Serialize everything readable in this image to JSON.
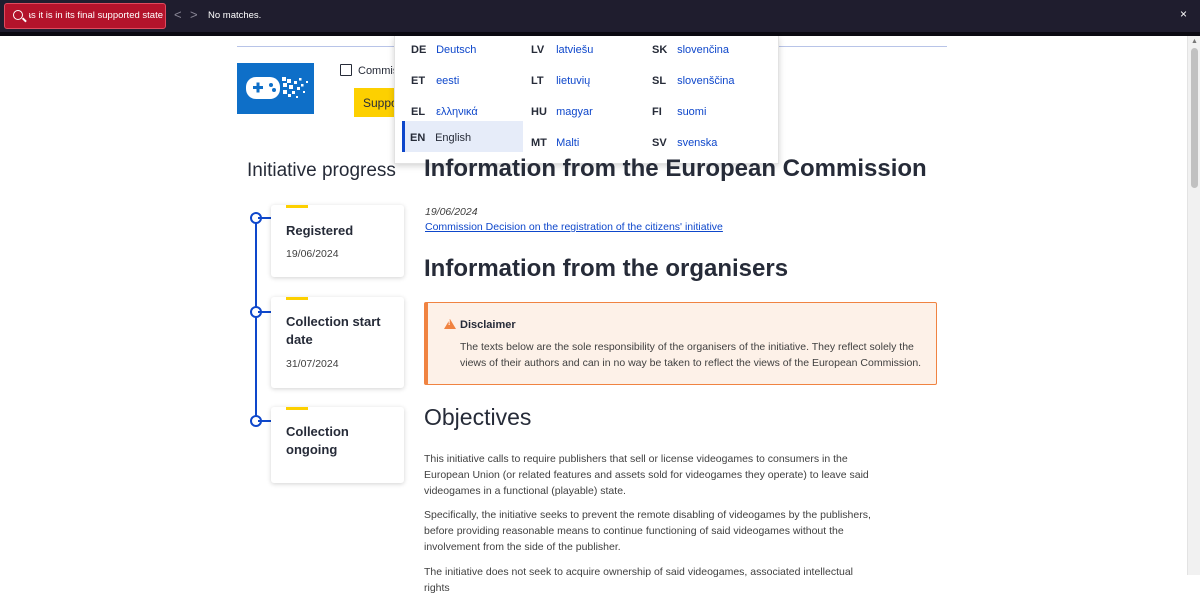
{
  "find_bar": {
    "query": "ctly as it is in its final supported state",
    "status": "No matches.",
    "prev_glyph": "<",
    "next_glyph": ">",
    "close_glyph": "×"
  },
  "header": {
    "commission_link": "Commis",
    "support_button": "Suppo"
  },
  "language_menu": {
    "items": [
      {
        "code": "DE",
        "name": "Deutsch"
      },
      {
        "code": "LV",
        "name": "latviešu"
      },
      {
        "code": "SK",
        "name": "slovenčina"
      },
      {
        "code": "ET",
        "name": "eesti"
      },
      {
        "code": "LT",
        "name": "lietuvių"
      },
      {
        "code": "SL",
        "name": "slovenščina"
      },
      {
        "code": "EL",
        "name": "ελληνικά"
      },
      {
        "code": "HU",
        "name": "magyar"
      },
      {
        "code": "FI",
        "name": "suomi"
      },
      {
        "code": "EN",
        "name": "English"
      },
      {
        "code": "MT",
        "name": "Malti"
      },
      {
        "code": "SV",
        "name": "svenska"
      }
    ],
    "selected": "EN"
  },
  "progress": {
    "title": "Initiative progress",
    "steps": [
      {
        "title": "Registered",
        "date": "19/06/2024"
      },
      {
        "title": "Collection start date",
        "date": "31/07/2024"
      },
      {
        "title": "Collection ongoing",
        "date": ""
      }
    ]
  },
  "main": {
    "commission_heading": "Information from the European Commission",
    "decision_date": "19/06/2024",
    "decision_link": "Commission Decision on the registration of the citizens' initiative",
    "organisers_heading": "Information from the organisers",
    "disclaimer": {
      "title": "Disclaimer",
      "text": "The texts below are the sole responsibility of the organisers of the initiative. They reflect solely the views of their authors and can in no way be taken to reflect the views of the European Commission."
    },
    "objectives_heading": "Objectives",
    "paragraphs": [
      "This initiative calls to require publishers that sell or license videogames to consumers in the European Union (or related features and assets sold for videogames they operate) to leave said videogames in a functional (playable) state.",
      "Specifically, the initiative seeks to prevent the remote disabling of videogames by the publishers, before providing reasonable means to continue functioning of said videogames without the involvement from the side of the publisher.",
      "The initiative does not seek to acquire ownership of said videogames, associated intellectual rights"
    ]
  },
  "colors": {
    "accent_blue": "#0e47cb",
    "support_yellow": "#fdd000",
    "disclaimer_orange": "#f08341",
    "find_bar_bg": "#1f1d2e",
    "find_field_red": "#b3132b"
  }
}
